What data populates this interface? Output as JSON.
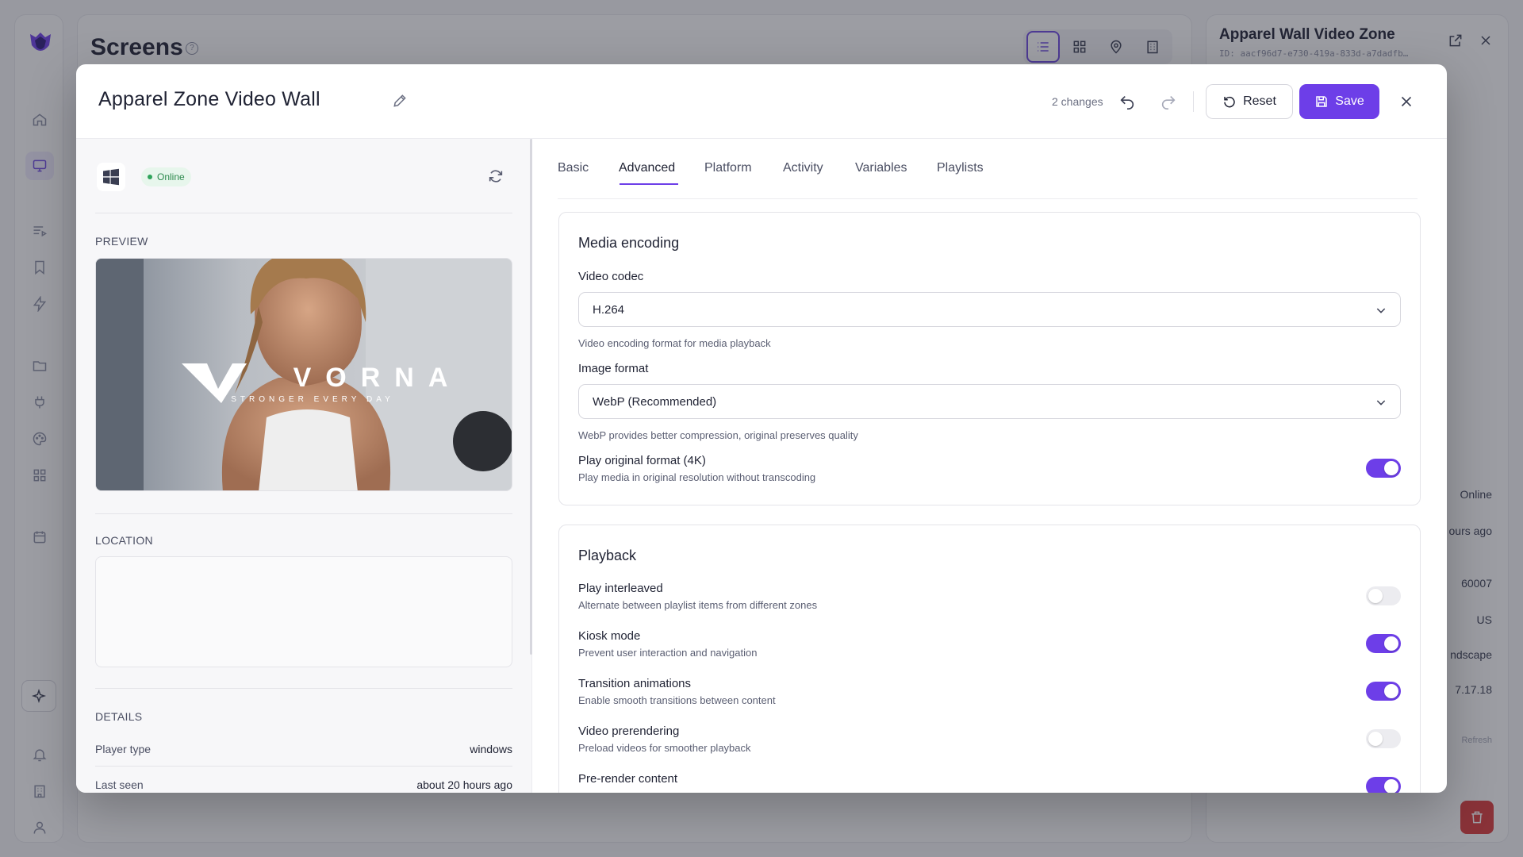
{
  "app": {
    "title": "Screens",
    "help_icon": "question-circle-icon",
    "right_panel": {
      "title": "Apparel Wall Video Zone",
      "id": "ID: aacf96d7-e730-419a-833d-a7dadfb…",
      "values": [
        "Online",
        "ours ago",
        "60007",
        "US",
        "ndscape",
        "7.17.18",
        "Refresh"
      ]
    }
  },
  "modal": {
    "title": "Apparel Zone Video Wall",
    "changes": "2 changes",
    "reset_label": "Reset",
    "save_label": "Save",
    "status": "Online",
    "preview_label": "PREVIEW",
    "preview_brand": "VORNA",
    "preview_tagline": "STRONGER EVERY DAY",
    "location_label": "LOCATION",
    "details_label": "DETAILS",
    "details": [
      {
        "key": "Player type",
        "value": "windows"
      },
      {
        "key": "Last seen",
        "value": "about 20 hours ago"
      }
    ],
    "tabs": [
      "Basic",
      "Advanced",
      "Platform",
      "Activity",
      "Variables",
      "Playlists"
    ],
    "active_tab": "Advanced",
    "media_encoding": {
      "title": "Media encoding",
      "video_codec_label": "Video codec",
      "video_codec_value": "H.264",
      "video_codec_help": "Video encoding format for media playback",
      "image_format_label": "Image format",
      "image_format_value": "WebP (Recommended)",
      "image_format_help": "WebP provides better compression, original preserves quality",
      "play_original_label": "Play original format (4K)",
      "play_original_help": "Play media in original resolution without transcoding",
      "play_original_on": true
    },
    "playback": {
      "title": "Playback",
      "items": [
        {
          "label": "Play interleaved",
          "help": "Alternate between playlist items from different zones",
          "on": false
        },
        {
          "label": "Kiosk mode",
          "help": "Prevent user interaction and navigation",
          "on": true
        },
        {
          "label": "Transition animations",
          "help": "Enable smooth transitions between content",
          "on": true
        },
        {
          "label": "Video prerendering",
          "help": "Preload videos for smoother playback",
          "on": false
        },
        {
          "label": "Pre-render content",
          "help": "",
          "on": true
        }
      ]
    }
  },
  "colors": {
    "accent": "#6d3ee8",
    "online": "#2fa45b",
    "danger": "#d93a3a"
  }
}
